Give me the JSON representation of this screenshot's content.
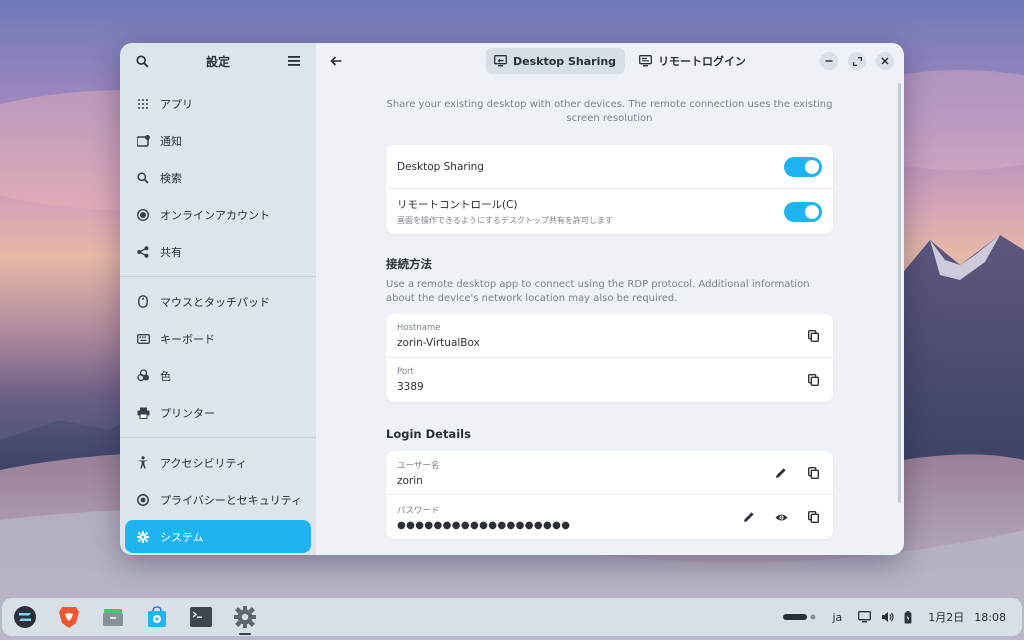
{
  "colors": {
    "accent": "#1eb4f2",
    "sidebar_bg": "#dde5ec",
    "main_bg": "#eef2f6",
    "text": "#2b2f36",
    "muted": "#7a828c"
  },
  "sidebar": {
    "title": "設定",
    "groups": [
      [
        {
          "label": "アプリ",
          "icon": "apps-grid-icon"
        },
        {
          "label": "通知",
          "icon": "notification-icon"
        },
        {
          "label": "検索",
          "icon": "search-icon"
        },
        {
          "label": "オンラインアカウント",
          "icon": "online-accounts-icon"
        },
        {
          "label": "共有",
          "icon": "share-icon"
        }
      ],
      [
        {
          "label": "マウスとタッチパッド",
          "icon": "mouse-icon"
        },
        {
          "label": "キーボード",
          "icon": "keyboard-icon"
        },
        {
          "label": "色",
          "icon": "color-icon"
        },
        {
          "label": "プリンター",
          "icon": "printer-icon"
        }
      ],
      [
        {
          "label": "アクセシビリティ",
          "icon": "accessibility-icon"
        },
        {
          "label": "プライバシーとセキュリティ",
          "icon": "privacy-icon"
        },
        {
          "label": "システム",
          "icon": "gear-icon",
          "active": true
        }
      ]
    ]
  },
  "header": {
    "tabs": [
      {
        "label": "Desktop Sharing",
        "selected": true
      },
      {
        "label": "リモートログイン",
        "selected": false
      }
    ]
  },
  "main": {
    "description": "Share your existing desktop with other devices. The remote connection uses the existing screen resolution",
    "toggles": {
      "desktop_sharing": {
        "title": "Desktop Sharing",
        "on": true
      },
      "remote_control": {
        "title": "リモートコントロール(C)",
        "subtitle": "画面を操作できるようにするデスクトップ共有を許可します",
        "on": true
      }
    },
    "connection": {
      "title": "接続方法",
      "description": "Use a remote desktop app to connect using the RDP protocol. Additional information about the device's network location may also be required.",
      "hostname_label": "Hostname",
      "hostname": "zorin-VirtualBox",
      "port_label": "Port",
      "port": "3389"
    },
    "login": {
      "title": "Login Details",
      "username_label": "ユーザー名",
      "username": "zorin",
      "password_label": "パスワード",
      "password": "●●●●●●●●●●●●●●●●●●●"
    }
  },
  "taskbar": {
    "apps": [
      "zorin-menu-icon",
      "brave-browser-icon",
      "files-icon",
      "software-store-icon",
      "terminal-icon",
      "settings-icon"
    ],
    "input_method": "ja",
    "date": "1月2日",
    "time": "18:08"
  }
}
